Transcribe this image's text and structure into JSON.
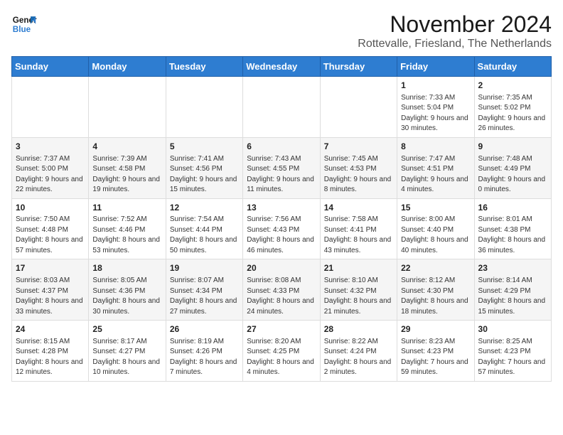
{
  "header": {
    "logo_line1": "General",
    "logo_line2": "Blue",
    "month": "November 2024",
    "location": "Rottevalle, Friesland, The Netherlands"
  },
  "weekdays": [
    "Sunday",
    "Monday",
    "Tuesday",
    "Wednesday",
    "Thursday",
    "Friday",
    "Saturday"
  ],
  "weeks": [
    [
      {
        "day": "",
        "info": ""
      },
      {
        "day": "",
        "info": ""
      },
      {
        "day": "",
        "info": ""
      },
      {
        "day": "",
        "info": ""
      },
      {
        "day": "",
        "info": ""
      },
      {
        "day": "1",
        "info": "Sunrise: 7:33 AM\nSunset: 5:04 PM\nDaylight: 9 hours and 30 minutes."
      },
      {
        "day": "2",
        "info": "Sunrise: 7:35 AM\nSunset: 5:02 PM\nDaylight: 9 hours and 26 minutes."
      }
    ],
    [
      {
        "day": "3",
        "info": "Sunrise: 7:37 AM\nSunset: 5:00 PM\nDaylight: 9 hours and 22 minutes."
      },
      {
        "day": "4",
        "info": "Sunrise: 7:39 AM\nSunset: 4:58 PM\nDaylight: 9 hours and 19 minutes."
      },
      {
        "day": "5",
        "info": "Sunrise: 7:41 AM\nSunset: 4:56 PM\nDaylight: 9 hours and 15 minutes."
      },
      {
        "day": "6",
        "info": "Sunrise: 7:43 AM\nSunset: 4:55 PM\nDaylight: 9 hours and 11 minutes."
      },
      {
        "day": "7",
        "info": "Sunrise: 7:45 AM\nSunset: 4:53 PM\nDaylight: 9 hours and 8 minutes."
      },
      {
        "day": "8",
        "info": "Sunrise: 7:47 AM\nSunset: 4:51 PM\nDaylight: 9 hours and 4 minutes."
      },
      {
        "day": "9",
        "info": "Sunrise: 7:48 AM\nSunset: 4:49 PM\nDaylight: 9 hours and 0 minutes."
      }
    ],
    [
      {
        "day": "10",
        "info": "Sunrise: 7:50 AM\nSunset: 4:48 PM\nDaylight: 8 hours and 57 minutes."
      },
      {
        "day": "11",
        "info": "Sunrise: 7:52 AM\nSunset: 4:46 PM\nDaylight: 8 hours and 53 minutes."
      },
      {
        "day": "12",
        "info": "Sunrise: 7:54 AM\nSunset: 4:44 PM\nDaylight: 8 hours and 50 minutes."
      },
      {
        "day": "13",
        "info": "Sunrise: 7:56 AM\nSunset: 4:43 PM\nDaylight: 8 hours and 46 minutes."
      },
      {
        "day": "14",
        "info": "Sunrise: 7:58 AM\nSunset: 4:41 PM\nDaylight: 8 hours and 43 minutes."
      },
      {
        "day": "15",
        "info": "Sunrise: 8:00 AM\nSunset: 4:40 PM\nDaylight: 8 hours and 40 minutes."
      },
      {
        "day": "16",
        "info": "Sunrise: 8:01 AM\nSunset: 4:38 PM\nDaylight: 8 hours and 36 minutes."
      }
    ],
    [
      {
        "day": "17",
        "info": "Sunrise: 8:03 AM\nSunset: 4:37 PM\nDaylight: 8 hours and 33 minutes."
      },
      {
        "day": "18",
        "info": "Sunrise: 8:05 AM\nSunset: 4:36 PM\nDaylight: 8 hours and 30 minutes."
      },
      {
        "day": "19",
        "info": "Sunrise: 8:07 AM\nSunset: 4:34 PM\nDaylight: 8 hours and 27 minutes."
      },
      {
        "day": "20",
        "info": "Sunrise: 8:08 AM\nSunset: 4:33 PM\nDaylight: 8 hours and 24 minutes."
      },
      {
        "day": "21",
        "info": "Sunrise: 8:10 AM\nSunset: 4:32 PM\nDaylight: 8 hours and 21 minutes."
      },
      {
        "day": "22",
        "info": "Sunrise: 8:12 AM\nSunset: 4:30 PM\nDaylight: 8 hours and 18 minutes."
      },
      {
        "day": "23",
        "info": "Sunrise: 8:14 AM\nSunset: 4:29 PM\nDaylight: 8 hours and 15 minutes."
      }
    ],
    [
      {
        "day": "24",
        "info": "Sunrise: 8:15 AM\nSunset: 4:28 PM\nDaylight: 8 hours and 12 minutes."
      },
      {
        "day": "25",
        "info": "Sunrise: 8:17 AM\nSunset: 4:27 PM\nDaylight: 8 hours and 10 minutes."
      },
      {
        "day": "26",
        "info": "Sunrise: 8:19 AM\nSunset: 4:26 PM\nDaylight: 8 hours and 7 minutes."
      },
      {
        "day": "27",
        "info": "Sunrise: 8:20 AM\nSunset: 4:25 PM\nDaylight: 8 hours and 4 minutes."
      },
      {
        "day": "28",
        "info": "Sunrise: 8:22 AM\nSunset: 4:24 PM\nDaylight: 8 hours and 2 minutes."
      },
      {
        "day": "29",
        "info": "Sunrise: 8:23 AM\nSunset: 4:23 PM\nDaylight: 7 hours and 59 minutes."
      },
      {
        "day": "30",
        "info": "Sunrise: 8:25 AM\nSunset: 4:23 PM\nDaylight: 7 hours and 57 minutes."
      }
    ]
  ]
}
